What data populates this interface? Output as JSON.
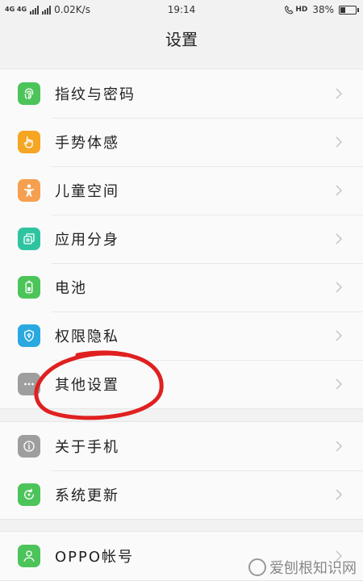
{
  "status_bar": {
    "network_label": "4G 4G",
    "speed": "0.02K/s",
    "time": "19:14",
    "hd_label": "HD",
    "battery_percent": "38%",
    "battery_level": 0.38
  },
  "header": {
    "title": "设置"
  },
  "sections": [
    {
      "items": [
        {
          "label": "指纹与密码",
          "icon": "fingerprint-icon",
          "color": "#4cc45a"
        },
        {
          "label": "手势体感",
          "icon": "gesture-hand-icon",
          "color": "#f5a623"
        },
        {
          "label": "儿童空间",
          "icon": "child-icon",
          "color": "#f5a050"
        },
        {
          "label": "应用分身",
          "icon": "app-clone-icon",
          "color": "#2ec4a0"
        },
        {
          "label": "电池",
          "icon": "battery-icon",
          "color": "#4cc45a"
        },
        {
          "label": "权限隐私",
          "icon": "privacy-shield-icon",
          "color": "#2aa8e0"
        },
        {
          "label": "其他设置",
          "icon": "more-dots-icon",
          "color": "#9e9e9e"
        }
      ]
    },
    {
      "items": [
        {
          "label": "关于手机",
          "icon": "info-icon",
          "color": "#9e9e9e"
        },
        {
          "label": "系统更新",
          "icon": "system-update-icon",
          "color": "#4cc45a"
        }
      ]
    },
    {
      "items": [
        {
          "label": "OPPO帐号",
          "icon": "account-icon",
          "color": "#4cc45a"
        }
      ]
    }
  ],
  "annotation_color": "#e02020",
  "watermark": {
    "text": "爱刨根知识网"
  }
}
